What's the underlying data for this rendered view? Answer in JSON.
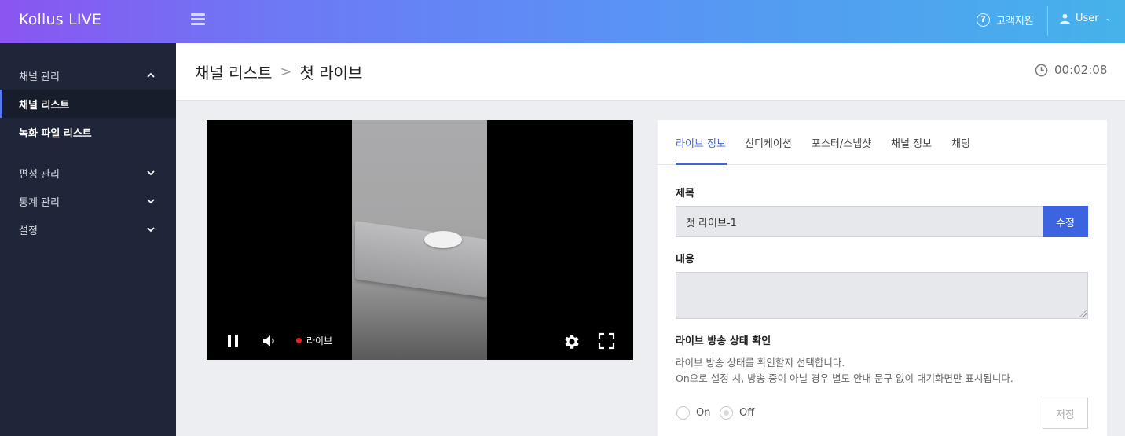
{
  "topbar": {
    "logo": "Kollus LIVE",
    "support_label": "고객지원",
    "user_label": "User",
    "gradient_colors": [
      "#8a55f0",
      "#45b2ea"
    ]
  },
  "sidebar": {
    "items": [
      {
        "label": "채널 관리",
        "icon": "chevron-up-icon"
      },
      {
        "label": "채널 리스트",
        "active": true
      },
      {
        "label": "녹화 파일 리스트"
      },
      {
        "label": "편성 관리",
        "icon": "chevron-down-icon"
      },
      {
        "label": "통계 관리",
        "icon": "chevron-down-icon"
      },
      {
        "label": "설정",
        "icon": "chevron-down-icon"
      }
    ]
  },
  "header": {
    "breadcrumb_parent": "채널 리스트",
    "breadcrumb_separator": ">",
    "breadcrumb_current": "첫 라이브",
    "elapsed_time": "00:02:08"
  },
  "player": {
    "live_label": "라이브",
    "live_dot_color": "#ee1c25",
    "controls": [
      "pause-icon",
      "volume-icon",
      "settings-icon",
      "fullscreen-icon"
    ]
  },
  "panel": {
    "tabs": [
      "라이브 정보",
      "신디케이션",
      "포스터/스냅샷",
      "채널 정보",
      "채팅"
    ],
    "active_tab": "라이브 정보",
    "title_label": "제목",
    "title_value": "첫 라이브-1",
    "edit_button": "수정",
    "content_label": "내용",
    "content_value": "",
    "status_label": "라이브 방송 상태 확인",
    "status_desc_1": "라이브 방송 상태를 확인할지 선택합니다.",
    "status_desc_2": "On으로 설정 시, 방송 중이 아닐 경우 별도 안내 문구 없이 대기화면만 표시됩니다.",
    "radio_on": "On",
    "radio_off": "Off",
    "radio_selected": "Off",
    "save_button": "저장",
    "accent_color": "#3c63e0"
  }
}
